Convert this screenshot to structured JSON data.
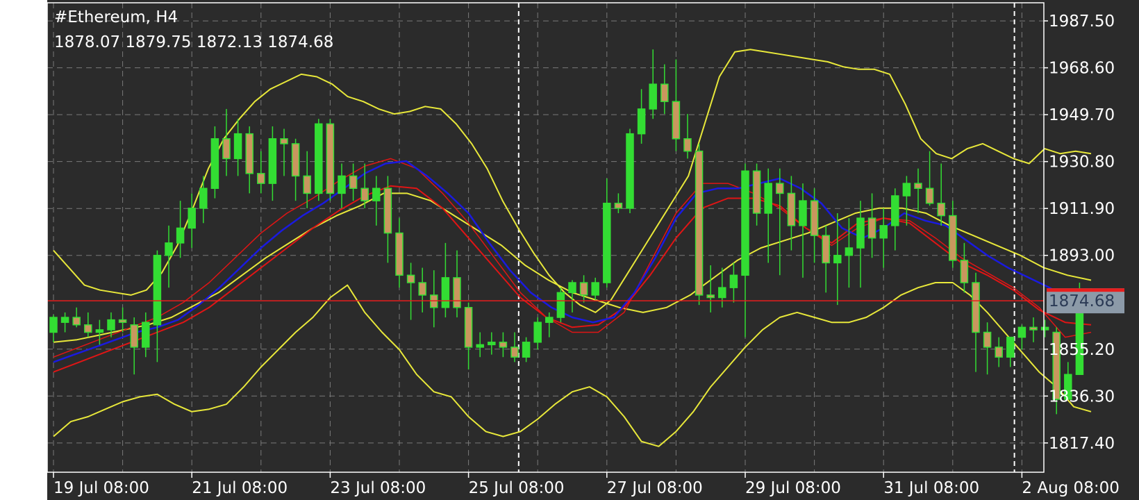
{
  "header": {
    "title": "#Ethereum, H4",
    "ohlc": "1878.07 1879.75 1872.13 1874.68"
  },
  "colors": {
    "background": "#2b2b2b",
    "grid": "#7a7a7a",
    "axis": "#ffffff",
    "bull_body": "#33dd33",
    "bear_body": "#c9975e",
    "wick": "#33dd33",
    "bollinger": "#e8e83a",
    "ma_blue": "#1a1ae0",
    "ma_red": "#e01515",
    "price_line": "#e81e1e",
    "price_label_bg": "#8c9aa8",
    "price_label_text": "#2b3a55"
  },
  "chart_data": {
    "type": "candlestick",
    "symbol": "#Ethereum",
    "timeframe": "H4",
    "ylim": [
      1805.6,
      1994.8
    ],
    "y_ticks": [
      1987.5,
      1968.6,
      1949.7,
      1930.8,
      1911.9,
      1893.0,
      1874.68,
      1855.2,
      1836.3,
      1817.4
    ],
    "y_tick_labels": [
      "1987.50",
      "1968.60",
      "1949.70",
      "1930.80",
      "1911.90",
      "1893.00",
      "1874.68",
      "1855.20",
      "1836.30",
      "1817.40"
    ],
    "x_ticks": [
      {
        "bar": 0,
        "label": "19 Jul 08:00"
      },
      {
        "bar": 12,
        "label": "21 Jul 08:00"
      },
      {
        "bar": 24,
        "label": "23 Jul 08:00"
      },
      {
        "bar": 36,
        "label": "25 Jul 08:00"
      },
      {
        "bar": 48,
        "label": "27 Jul 08:00"
      },
      {
        "bar": 60,
        "label": "29 Jul 08:00"
      },
      {
        "bar": 72,
        "label": "31 Jul 08:00"
      },
      {
        "bar": 84,
        "label": "2 Aug 08:00"
      }
    ],
    "day_separators": [
      40,
      83
    ],
    "current_price": 1874.68,
    "ohlc": [
      [
        1862,
        1869,
        1858,
        1868
      ],
      [
        1866,
        1870,
        1862,
        1868
      ],
      [
        1868,
        1872,
        1864,
        1865
      ],
      [
        1865,
        1870,
        1860,
        1862
      ],
      [
        1862,
        1867,
        1857,
        1863
      ],
      [
        1863,
        1870,
        1860,
        1867
      ],
      [
        1867,
        1872,
        1862,
        1866
      ],
      [
        1865,
        1868,
        1845,
        1856
      ],
      [
        1856,
        1870,
        1852,
        1866
      ],
      [
        1865,
        1895,
        1850,
        1893
      ],
      [
        1893,
        1905,
        1880,
        1898
      ],
      [
        1898,
        1915,
        1892,
        1904
      ],
      [
        1904,
        1918,
        1896,
        1912
      ],
      [
        1912,
        1925,
        1906,
        1920
      ],
      [
        1920,
        1945,
        1916,
        1940
      ],
      [
        1940,
        1952,
        1925,
        1932
      ],
      [
        1932,
        1948,
        1925,
        1942
      ],
      [
        1942,
        1945,
        1918,
        1926
      ],
      [
        1926,
        1935,
        1918,
        1922
      ],
      [
        1922,
        1945,
        1915,
        1940
      ],
      [
        1940,
        1944,
        1925,
        1938
      ],
      [
        1938,
        1940,
        1915,
        1925
      ],
      [
        1925,
        1935,
        1912,
        1918
      ],
      [
        1918,
        1948,
        1915,
        1946
      ],
      [
        1946,
        1948,
        1915,
        1918
      ],
      [
        1918,
        1930,
        1912,
        1925
      ],
      [
        1925,
        1930,
        1915,
        1920
      ],
      [
        1920,
        1930,
        1912,
        1915
      ],
      [
        1915,
        1925,
        1905,
        1920
      ],
      [
        1920,
        1925,
        1890,
        1902
      ],
      [
        1902,
        1908,
        1880,
        1885
      ],
      [
        1885,
        1890,
        1867,
        1882
      ],
      [
        1882,
        1888,
        1870,
        1877
      ],
      [
        1877,
        1887,
        1864,
        1872
      ],
      [
        1872,
        1898,
        1868,
        1884
      ],
      [
        1884,
        1895,
        1868,
        1872
      ],
      [
        1872,
        1874,
        1847,
        1856
      ],
      [
        1856,
        1862,
        1852,
        1857
      ],
      [
        1857,
        1862,
        1853,
        1858
      ],
      [
        1858,
        1862,
        1852,
        1856
      ],
      [
        1856,
        1862,
        1850,
        1852
      ],
      [
        1852,
        1860,
        1850,
        1858
      ],
      [
        1858,
        1868,
        1855,
        1866
      ],
      [
        1866,
        1870,
        1860,
        1868
      ],
      [
        1868,
        1880,
        1866,
        1878
      ],
      [
        1878,
        1883,
        1870,
        1882
      ],
      [
        1882,
        1885,
        1874,
        1877
      ],
      [
        1877,
        1884,
        1875,
        1882
      ],
      [
        1882,
        1924,
        1880,
        1914
      ],
      [
        1914,
        1918,
        1910,
        1912
      ],
      [
        1912,
        1944,
        1910,
        1942
      ],
      [
        1942,
        1960,
        1938,
        1952
      ],
      [
        1952,
        1976,
        1948,
        1962
      ],
      [
        1962,
        1970,
        1950,
        1955
      ],
      [
        1955,
        1972,
        1935,
        1940
      ],
      [
        1940,
        1950,
        1932,
        1935
      ],
      [
        1935,
        1938,
        1873,
        1877
      ],
      [
        1877,
        1889,
        1870,
        1876
      ],
      [
        1876,
        1888,
        1872,
        1880
      ],
      [
        1880,
        1890,
        1874,
        1885
      ],
      [
        1885,
        1930,
        1860,
        1927
      ],
      [
        1927,
        1930,
        1905,
        1910
      ],
      [
        1910,
        1928,
        1890,
        1922
      ],
      [
        1922,
        1928,
        1885,
        1918
      ],
      [
        1918,
        1925,
        1895,
        1905
      ],
      [
        1905,
        1922,
        1884,
        1915
      ],
      [
        1915,
        1920,
        1890,
        1901
      ],
      [
        1901,
        1905,
        1878,
        1890
      ],
      [
        1890,
        1910,
        1873,
        1893
      ],
      [
        1893,
        1908,
        1880,
        1896
      ],
      [
        1896,
        1915,
        1880,
        1908
      ],
      [
        1908,
        1918,
        1892,
        1900
      ],
      [
        1900,
        1912,
        1888,
        1905
      ],
      [
        1905,
        1920,
        1895,
        1917
      ],
      [
        1917,
        1925,
        1905,
        1922
      ],
      [
        1922,
        1928,
        1910,
        1920
      ],
      [
        1920,
        1935,
        1913,
        1914
      ],
      [
        1914,
        1930,
        1905,
        1909
      ],
      [
        1909,
        1915,
        1888,
        1891
      ],
      [
        1891,
        1898,
        1878,
        1882
      ],
      [
        1882,
        1886,
        1846,
        1862
      ],
      [
        1862,
        1866,
        1845,
        1856
      ],
      [
        1856,
        1860,
        1848,
        1852
      ],
      [
        1852,
        1860,
        1848,
        1860
      ],
      [
        1860,
        1865,
        1855,
        1864
      ],
      [
        1864,
        1868,
        1858,
        1863
      ],
      [
        1863,
        1867,
        1860,
        1864
      ],
      [
        1862,
        1864,
        1829,
        1835
      ],
      [
        1835,
        1850,
        1835,
        1845
      ],
      [
        1845,
        1882,
        1845,
        1878
      ],
      [
        1878.07,
        1879.75,
        1872.13,
        1874.68
      ]
    ],
    "bollinger_upper": [
      1895,
      1888,
      1881,
      1879,
      1878,
      1877,
      1879,
      1886,
      1897,
      1912,
      1928,
      1940,
      1948,
      1955,
      1960,
      1963,
      1966,
      1965,
      1962,
      1957,
      1955,
      1952,
      1950,
      1951,
      1953,
      1952,
      1946,
      1938,
      1928,
      1915,
      1904,
      1894,
      1885,
      1878,
      1873,
      1870,
      1875,
      1885,
      1895,
      1905,
      1915,
      1925,
      1945,
      1965,
      1975,
      1976,
      1975,
      1974,
      1973,
      1972,
      1971,
      1969,
      1968,
      1968,
      1966,
      1954,
      1940,
      1934,
      1932,
      1936,
      1938,
      1935,
      1932,
      1930,
      1936,
      1934,
      1935,
      1934
    ],
    "bollinger_middle": [
      1858,
      1859,
      1861,
      1863,
      1865,
      1868,
      1873,
      1878,
      1885,
      1892,
      1898,
      1904,
      1909,
      1913,
      1918,
      1918,
      1915,
      1909,
      1903,
      1897,
      1889,
      1883,
      1878,
      1875,
      1872,
      1870,
      1872,
      1877,
      1884,
      1891,
      1896,
      1899,
      1902,
      1906,
      1910,
      1912,
      1912,
      1910,
      1905,
      1901,
      1897,
      1893,
      1888,
      1885,
      1883
    ],
    "bollinger_lower": [
      1820,
      1826,
      1828,
      1831,
      1834,
      1836,
      1837,
      1833,
      1830,
      1831,
      1833,
      1840,
      1848,
      1855,
      1862,
      1868,
      1876,
      1881,
      1870,
      1862,
      1855,
      1845,
      1838,
      1836,
      1828,
      1822,
      1820,
      1822,
      1827,
      1833,
      1838,
      1840,
      1836,
      1828,
      1818,
      1816,
      1822,
      1830,
      1840,
      1848,
      1856,
      1863,
      1868,
      1870,
      1868,
      1866,
      1866,
      1868,
      1872,
      1877,
      1880,
      1882,
      1882,
      1877,
      1870,
      1862,
      1854,
      1846,
      1840,
      1832,
      1830
    ],
    "ma_blue": [
      1850,
      1853,
      1856,
      1859,
      1862,
      1864,
      1867,
      1873,
      1880,
      1888,
      1896,
      1903,
      1909,
      1914,
      1920,
      1926,
      1930,
      1931,
      1925,
      1918,
      1910,
      1898,
      1887,
      1878,
      1872,
      1868,
      1866,
      1868,
      1878,
      1892,
      1908,
      1918,
      1920,
      1920,
      1922,
      1924,
      1920,
      1914,
      1904,
      1900,
      1904,
      1910,
      1907,
      1905,
      1899,
      1893,
      1888,
      1884,
      1880,
      1875,
      1871
    ],
    "ma_red_fast": [
      1852,
      1856,
      1860,
      1864,
      1868,
      1874,
      1882,
      1892,
      1902,
      1910,
      1916,
      1923,
      1929,
      1932,
      1928,
      1918,
      1906,
      1892,
      1878,
      1868,
      1862,
      1862,
      1870,
      1890,
      1910,
      1922,
      1922,
      1918,
      1912,
      1904,
      1897,
      1904,
      1908,
      1907,
      1900,
      1892,
      1886,
      1880,
      1872,
      1860,
      1862
    ],
    "ma_red_slow": [
      1846,
      1850,
      1854,
      1858,
      1862,
      1866,
      1872,
      1880,
      1888,
      1896,
      1904,
      1911,
      1917,
      1921,
      1920,
      1912,
      1900,
      1888,
      1876,
      1868,
      1864,
      1865,
      1872,
      1885,
      1900,
      1912,
      1916,
      1916,
      1913,
      1904,
      1898,
      1906,
      1908,
      1906,
      1898,
      1890,
      1885,
      1879,
      1871,
      1866,
      1865
    ]
  }
}
